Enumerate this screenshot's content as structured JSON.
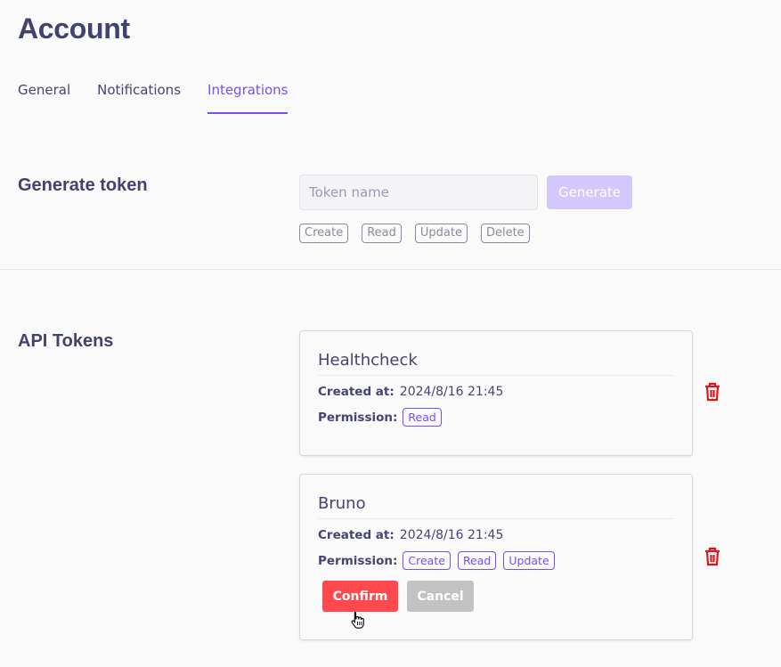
{
  "page": {
    "title": "Account"
  },
  "tabs": [
    {
      "label": "General",
      "active": false
    },
    {
      "label": "Notifications",
      "active": false
    },
    {
      "label": "Integrations",
      "active": true
    }
  ],
  "generate": {
    "title": "Generate token",
    "input_placeholder": "Token name",
    "input_value": "",
    "button_label": "Generate",
    "permissions": [
      "Create",
      "Read",
      "Update",
      "Delete"
    ]
  },
  "api_tokens": {
    "title": "API Tokens",
    "created_label": "Created at:",
    "permission_label": "Permission:",
    "items": [
      {
        "name": "Healthcheck",
        "created_at": "2024/8/16 21:45",
        "permissions": [
          "Read"
        ]
      },
      {
        "name": "Bruno",
        "created_at": "2024/8/16 21:45",
        "permissions": [
          "Create",
          "Read",
          "Update"
        ],
        "confirm_label": "Confirm",
        "cancel_label": "Cancel"
      }
    ]
  },
  "colors": {
    "accent": "#7650f0",
    "danger": "#fe4a4f",
    "text": "#454571",
    "trash": "#e0141b"
  },
  "icons": {
    "delete": "trash-icon",
    "cursor": "hand-pointer-cursor-icon"
  }
}
